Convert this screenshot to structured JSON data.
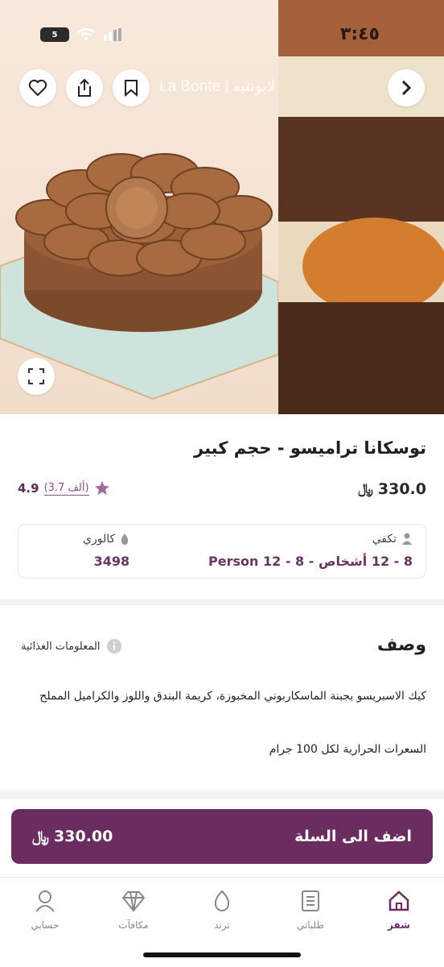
{
  "status_bar": {
    "time": "٣:٤٥",
    "battery": "5"
  },
  "hero": {
    "brand": "La Bonte | لابونتيه"
  },
  "product": {
    "title": "توسكانا تراميسو - حجم كبير",
    "price": "330.0",
    "rating_score": "4.9",
    "rating_count": "(3.7 ألف)"
  },
  "info": {
    "serves_label": "تكفي",
    "serves_value": "8 - 12 أشخاص - 8 - 12 Person",
    "calories_label": "كالوري",
    "calories_value": "3498"
  },
  "description": {
    "title": "وصف",
    "nutrition_link": "المعلومات الغذائية",
    "text": "كيك الاسبريسو بجبنة الماسكاربوني المخبوزة، كريمة البندق واللوز والكراميل المملح",
    "calories_note": "السعرات الحرارية لكل 100 جرام"
  },
  "cart": {
    "label": "اضف الى السلة",
    "price": "330.00"
  },
  "tabs": [
    {
      "label": "شفز",
      "icon": "home-icon"
    },
    {
      "label": "طلباتي",
      "icon": "orders-icon"
    },
    {
      "label": "ترند",
      "icon": "trend-icon"
    },
    {
      "label": "مكافآت",
      "icon": "diamond-icon"
    },
    {
      "label": "حسابي",
      "icon": "user-icon"
    }
  ],
  "colors": {
    "brand": "#6b2d5f",
    "accent": "#8a4f86"
  }
}
